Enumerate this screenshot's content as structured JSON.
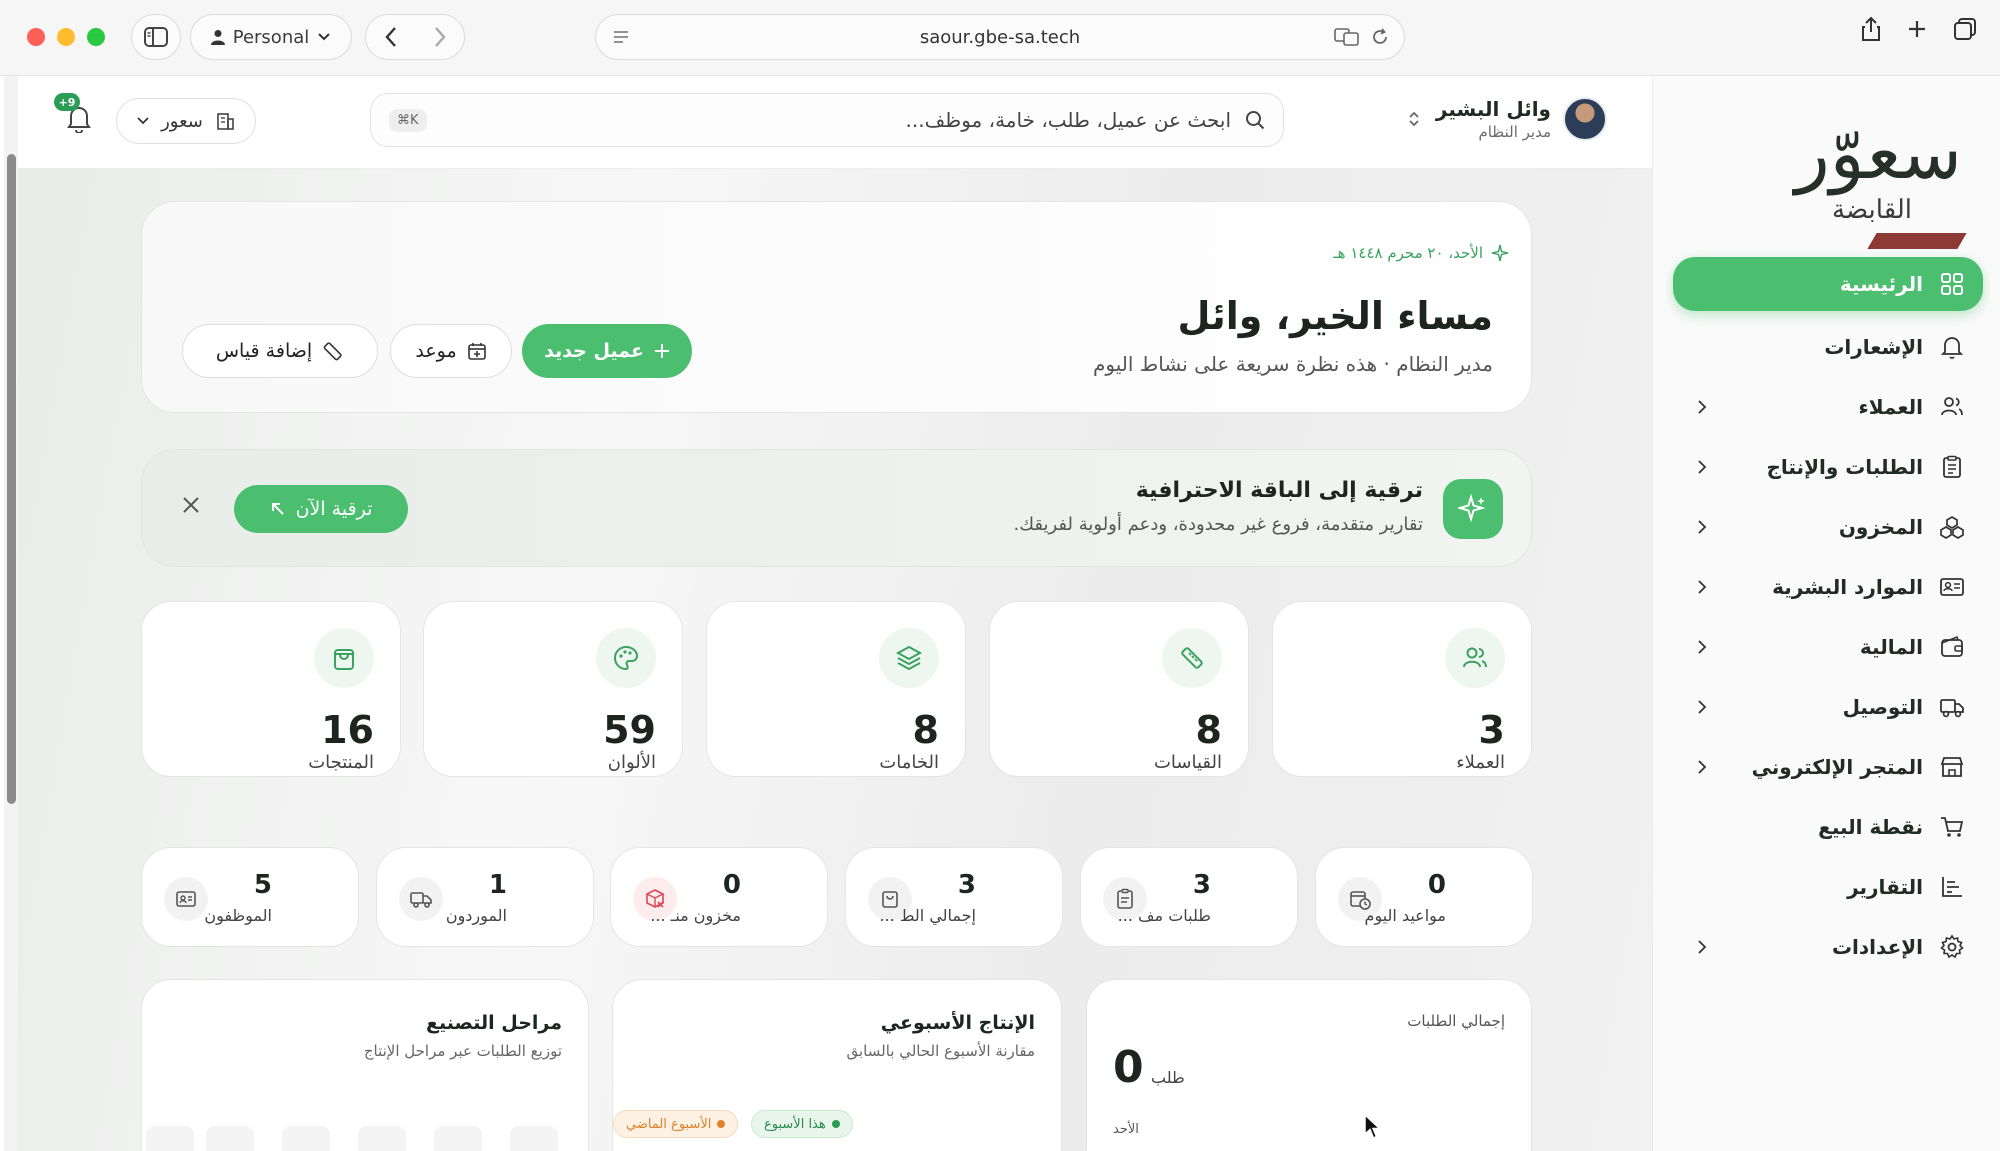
{
  "browser": {
    "profile": "Personal",
    "url": "saour.gbe-sa.tech"
  },
  "brand": {
    "name": "سعوّر",
    "subtitle": "القابضة",
    "accent": "#4bbf6f",
    "logo_bar_color": "#8c3a33"
  },
  "sidebar": {
    "items": [
      {
        "label": "الرئيسية",
        "icon": "grid-icon",
        "active": true,
        "has_chevron": false
      },
      {
        "label": "الإشعارات",
        "icon": "bell-icon",
        "active": false,
        "has_chevron": false
      },
      {
        "label": "العملاء",
        "icon": "users-icon",
        "active": false,
        "has_chevron": true
      },
      {
        "label": "الطلبات والإنتاج",
        "icon": "clipboard-icon",
        "active": false,
        "has_chevron": true
      },
      {
        "label": "المخزون",
        "icon": "boxes-icon",
        "active": false,
        "has_chevron": true
      },
      {
        "label": "الموارد البشرية",
        "icon": "id-card-icon",
        "active": false,
        "has_chevron": true
      },
      {
        "label": "المالية",
        "icon": "wallet-icon",
        "active": false,
        "has_chevron": true
      },
      {
        "label": "التوصيل",
        "icon": "truck-icon",
        "active": false,
        "has_chevron": true
      },
      {
        "label": "المتجر الإلكتروني",
        "icon": "store-icon",
        "active": false,
        "has_chevron": true
      },
      {
        "label": "نقطة البيع",
        "icon": "cart-icon",
        "active": false,
        "has_chevron": false
      },
      {
        "label": "التقارير",
        "icon": "chart-icon",
        "active": false,
        "has_chevron": false
      },
      {
        "label": "الإعدادات",
        "icon": "gear-icon",
        "active": false,
        "has_chevron": true
      }
    ]
  },
  "header": {
    "user_name": "وائل البشير",
    "user_role": "مدير النظام",
    "search_placeholder": "ابحث عن عميل، طلب، خامة، موظف...",
    "search_shortcut": "⌘K",
    "branch": "سعور",
    "notification_badge": "+9"
  },
  "welcome": {
    "date": "الأحد، ٢٠ محرم ١٤٤٨ هـ",
    "greeting": "مساء الخير، وائل",
    "subtitle": "مدير النظام · هذه نظرة سريعة على نشاط اليوم",
    "new_client_label": "عميل جديد",
    "appointment_label": "موعد",
    "add_measurement_label": "إضافة قياس"
  },
  "upgrade": {
    "title": "ترقية إلى الباقة الاحترافية",
    "subtitle": "تقارير متقدمة، فروع غير محدودة، ودعم أولوية لفريقك.",
    "button_label": "ترقية الآن"
  },
  "stats": [
    {
      "value": "3",
      "label": "العملاء",
      "icon": "users-icon"
    },
    {
      "value": "8",
      "label": "القياسات",
      "icon": "ruler-icon"
    },
    {
      "value": "8",
      "label": "الخامات",
      "icon": "layers-icon"
    },
    {
      "value": "59",
      "label": "الألوان",
      "icon": "palette-icon"
    },
    {
      "value": "16",
      "label": "المنتجات",
      "icon": "bag-icon"
    }
  ],
  "mini_stats": [
    {
      "value": "0",
      "label": "مواعيد اليوم",
      "icon": "calendar-clock-icon",
      "alert": false
    },
    {
      "value": "3",
      "label": "طلبات مف ...",
      "icon": "clipboard-icon",
      "alert": false
    },
    {
      "value": "3",
      "label": "إجمالي الط ...",
      "icon": "bag-icon",
      "alert": false
    },
    {
      "value": "0",
      "label": "مخزون منـ ...",
      "icon": "box-x-icon",
      "alert": true
    },
    {
      "value": "1",
      "label": "الموردون",
      "icon": "truck-icon",
      "alert": false
    },
    {
      "value": "5",
      "label": "الموظفون",
      "icon": "id-card-icon",
      "alert": false
    }
  ],
  "panels": {
    "orders": {
      "title": "إجمالي الطلبات",
      "value": "0",
      "unit": "طلب",
      "day": "الأحد"
    },
    "weekly": {
      "title": "الإنتاج الأسبوعي",
      "subtitle": "مقارنة الأسبوع الحالي بالسابق",
      "this_week": "هذا الأسبوع",
      "last_week": "الأسبوع الماضي"
    },
    "stages": {
      "title": "مراحل التصنيع",
      "subtitle": "توزيع الطلبات عبر مراحل الإنتاج"
    }
  }
}
